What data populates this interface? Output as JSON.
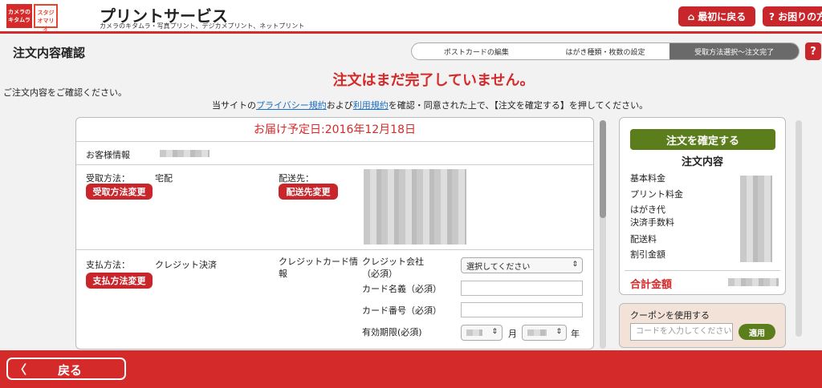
{
  "header": {
    "logo1_text": "カメラのキタムラ",
    "logo2_text": "スタジオマリオ",
    "title": "プリントサービス",
    "subtitle": "カメラのキタムラ・写真プリント、デジカメプリント、ネットプリント",
    "home_button": "最初に戻る",
    "help_button": "? お困りの方"
  },
  "page": {
    "title": "注文内容確認",
    "steps": [
      "ポストカードの編集",
      "はがき種類・枚数の設定",
      "受取方法選択〜注文完了"
    ],
    "help_icon": "?",
    "warning": "注文はまだ完了していません。",
    "confirm_note": "ご注文内容をご確認ください。",
    "agree_pre": "当サイトの",
    "privacy_link": "プライバシー規約",
    "agree_mid": "および",
    "terms_link": "利用規約",
    "agree_post": "を確認・同意された上で、【注文を確定する】を押してください。"
  },
  "order": {
    "delivery_date": "お届け予定日:2016年12月18日",
    "customer_label": "お客様情報",
    "receive_label": "受取方法：",
    "receive_value": "宅配",
    "receive_change": "受取方法変更",
    "ship_label": "配送先：",
    "ship_change": "配送先変更",
    "pay_label": "支払方法：",
    "pay_value": "クレジット決済",
    "pay_change": "支払方法変更",
    "card_info_label": "クレジットカード情報",
    "card_company_label": "クレジット会社（必須）",
    "card_company_select": "選択してください",
    "card_name_label": "カード名義（必須）",
    "card_number_label": "カード番号（必須）",
    "expiry_label": "有効期限(必須)",
    "month_unit": "月",
    "year_unit": "年"
  },
  "summary": {
    "confirm_button": "注文を確定する",
    "title": "注文内容",
    "fees": [
      "基本料金",
      "プリント料金",
      "はがき代",
      "決済手数料",
      "配送料",
      "割引金額"
    ],
    "total_label": "合計金額"
  },
  "coupon": {
    "title": "クーポンを使用する",
    "placeholder": "コードを入力してください",
    "apply_button": "適用"
  },
  "footer": {
    "back_button": "戻る"
  },
  "colors": {
    "accent_red": "#d42a2a",
    "button_green": "#5b7d1b",
    "link_blue": "#1a6fc7"
  }
}
